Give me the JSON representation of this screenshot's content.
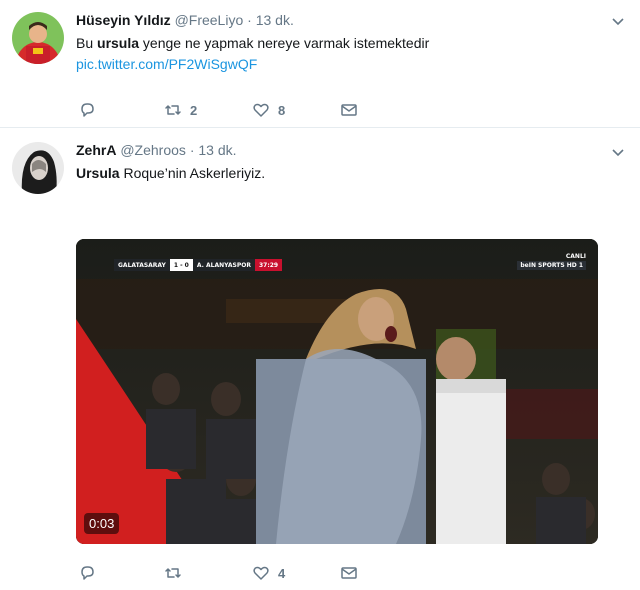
{
  "tweets": [
    {
      "display_name": "Hüseyin Yıldız",
      "handle": "@FreeLiyo",
      "separator": "·",
      "time": "13 dk.",
      "text_prefix": "Bu ",
      "text_bold": "ursula",
      "text_suffix": " yenge  ne yapmak nereye varmak istemektedir",
      "link": "pic.twitter.com/PF2WiSgwQF",
      "actions": {
        "reply_count": "",
        "retweet_count": "2",
        "like_count": "8"
      }
    },
    {
      "display_name": "ZehrA",
      "handle": "@Zehroos",
      "separator": "·",
      "time": "13 dk.",
      "text_bold": "Ursula",
      "text_suffix": " Roque’nin Askerleriyiz.",
      "video": {
        "home_team": "GALATASARAY",
        "score": "1 - 0",
        "away_team": "A. ALANYASPOR",
        "clock": "37:29",
        "broadcaster_label": "CANLI",
        "channel": "beIN SPORTS HD 1",
        "duration": "0:03"
      },
      "actions": {
        "reply_count": "",
        "retweet_count": "",
        "like_count": "4"
      }
    }
  ],
  "colors": {
    "link": "#1b95e0",
    "meta": "#657786",
    "divider": "#e6ecf0"
  }
}
